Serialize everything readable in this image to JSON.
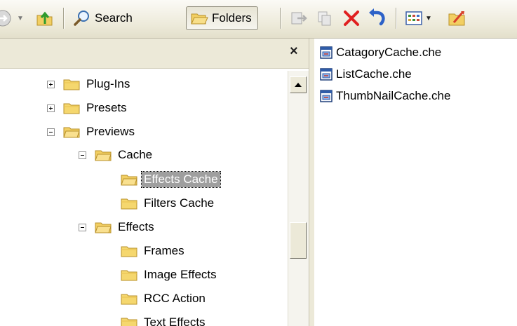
{
  "toolbar": {
    "search_label": "Search",
    "folders_label": "Folders"
  },
  "folders_pane": {
    "close_glyph": "×"
  },
  "tree": [
    {
      "label": "Plug-Ins",
      "expander": "plus",
      "icon": "folder-icon"
    },
    {
      "label": "Presets",
      "expander": "plus",
      "icon": "folder-icon"
    },
    {
      "label": "Previews",
      "expander": "minus",
      "icon": "folder-open-icon"
    },
    {
      "label": "Cache",
      "expander": "minus",
      "icon": "folder-open-icon"
    },
    {
      "label": "Effects Cache",
      "expander": "none",
      "icon": "folder-open-icon",
      "selected": true
    },
    {
      "label": "Filters Cache",
      "expander": "none",
      "icon": "folder-icon"
    },
    {
      "label": "Effects",
      "expander": "minus",
      "icon": "folder-open-icon"
    },
    {
      "label": "Frames",
      "expander": "none",
      "icon": "folder-icon"
    },
    {
      "label": "Image Effects",
      "expander": "none",
      "icon": "folder-icon"
    },
    {
      "label": "RCC Action",
      "expander": "none",
      "icon": "folder-icon"
    },
    {
      "label": "Text Effects",
      "expander": "none",
      "icon": "folder-icon"
    }
  ],
  "files": [
    {
      "label": "CatagoryCache.che",
      "icon": "cache-file-icon"
    },
    {
      "label": "ListCache.che",
      "icon": "cache-file-icon"
    },
    {
      "label": "ThumbNailCache.che",
      "icon": "cache-file-icon"
    }
  ],
  "colors": {
    "folder_yellow": "#f5d76e",
    "selection_gray": "#9f9f9f",
    "toolbar_bg": "#ece9d8",
    "delete_red": "#e02020"
  }
}
